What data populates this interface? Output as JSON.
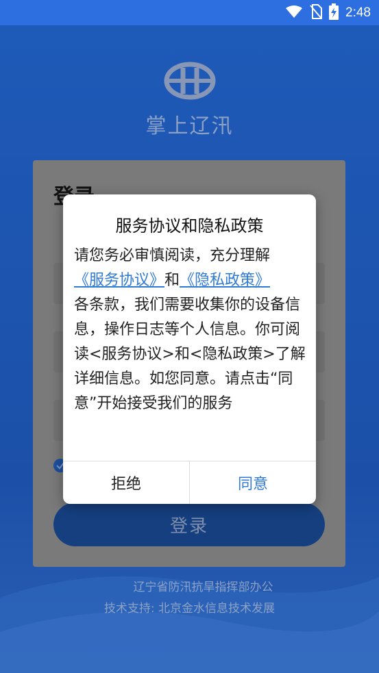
{
  "status_bar": {
    "time": "2:48"
  },
  "app": {
    "name": "掌上辽汛"
  },
  "login": {
    "title": "登录",
    "button_label": "登录"
  },
  "footer": {
    "org": "辽宁省防汛抗旱指挥部办公",
    "support": "技术支持: 北京金水信息技术发展"
  },
  "dialog": {
    "title": "服务协议和隐私政策",
    "line1": "请您务必审慎阅读，充分理解",
    "link_service": "《服务协议》",
    "and_text": "和",
    "link_privacy": "《隐私政策》",
    "rest": "各条款，我们需要收集你的设备信息，操作日志等个人信息。你可阅读<服务协议>和<隐私政策>了解详细信息。如您同意。请点击“同意”开始接受我们的服务",
    "reject_label": "拒绝",
    "agree_label": "同意"
  },
  "colors": {
    "accent": "#2f7ad6",
    "statusbar": "#2d6fe0",
    "background": "#1f58b8"
  },
  "icons": [
    "wifi-icon",
    "no-sim-icon",
    "battery-charging-icon",
    "app-logo-icon",
    "check-icon"
  ]
}
